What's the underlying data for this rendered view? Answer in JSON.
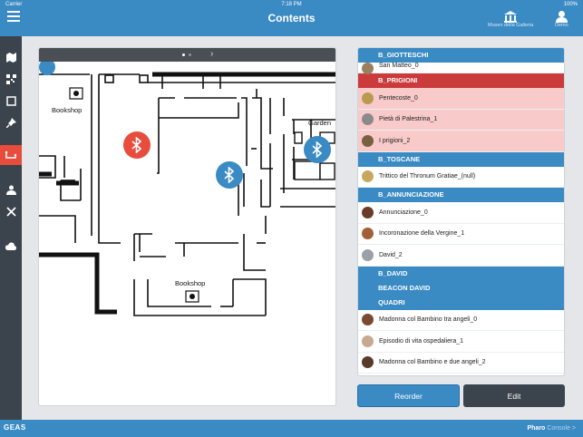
{
  "status": {
    "carrier": "Carrier",
    "time": "7:18 PM",
    "battery": "100%"
  },
  "header": {
    "title": "Contents",
    "museum_label": "Museo della Galleria",
    "user_label": "Demo"
  },
  "sidebar": {
    "items": [
      {
        "name": "map-icon",
        "active": false
      },
      {
        "name": "qr-icon",
        "active": false
      },
      {
        "name": "frame-icon",
        "active": false
      },
      {
        "name": "pin-icon",
        "active": false
      },
      {
        "name": "route-icon",
        "active": true
      },
      {
        "name": "user-group-icon",
        "active": false
      },
      {
        "name": "tools-icon",
        "active": false
      },
      {
        "name": "cloud-icon",
        "active": false
      }
    ]
  },
  "map": {
    "labels": {
      "bookshop_top": "Bookshop",
      "bookshop_bottom": "Bookshop",
      "garden": "Garden"
    },
    "pager_arrow": "›",
    "beacon_colors": {
      "active": "#e74c3c",
      "normal": "#3a8ac4"
    }
  },
  "list": {
    "sections": [
      {
        "title": "B_GIOTTESCHI",
        "color": "#3a8ac4",
        "rows": [
          {
            "label": "San Matteo_0",
            "avatar": "#9a8060",
            "pink": false
          }
        ]
      },
      {
        "title": "B_PRIGIONI",
        "color": "#cc3b3b",
        "rows": [
          {
            "label": "Pentecoste_0",
            "avatar": "#b89a50",
            "pink": true
          },
          {
            "label": "Pietà di Palestrina_1",
            "avatar": "#8a8a8a",
            "pink": true
          },
          {
            "label": "I prigioni_2",
            "avatar": "#7a6040",
            "pink": true
          }
        ]
      },
      {
        "title": "B_TOSCANE",
        "color": "#3a8ac4",
        "rows": [
          {
            "label": "Trittico del Thronum Gratiae_(null)",
            "avatar": "#c8a860",
            "pink": false
          }
        ]
      },
      {
        "title": "B_ANNUNCIAZIONE",
        "color": "#3a8ac4",
        "rows": [
          {
            "label": "Annunciazione_0",
            "avatar": "#6a3c28",
            "pink": false
          },
          {
            "label": "Incoronazione della Vergine_1",
            "avatar": "#a06038",
            "pink": false
          },
          {
            "label": "David_2",
            "avatar": "#9aa0a6",
            "pink": false
          }
        ]
      },
      {
        "title": "B_DAVID",
        "color": "#3a8ac4",
        "rows": []
      },
      {
        "title": "BEACON DAVID",
        "color": "#3a8ac4",
        "rows": []
      },
      {
        "title": "QUADRI",
        "color": "#3a8ac4",
        "rows": [
          {
            "label": "Madonna col Bambino tra angeli_0",
            "avatar": "#7a4a30",
            "pink": false
          },
          {
            "label": "Episodio di vita ospedaliera_1",
            "avatar": "#c8a890",
            "pink": false
          },
          {
            "label": "Madonna col Bambino e due angeli_2",
            "avatar": "#5a3a28",
            "pink": false
          }
        ]
      }
    ]
  },
  "buttons": {
    "reorder": "Reorder",
    "edit": "Edit"
  },
  "footer": {
    "logo": "GEAS",
    "brand": "Pharo",
    "brand_suffix": "Console >"
  }
}
